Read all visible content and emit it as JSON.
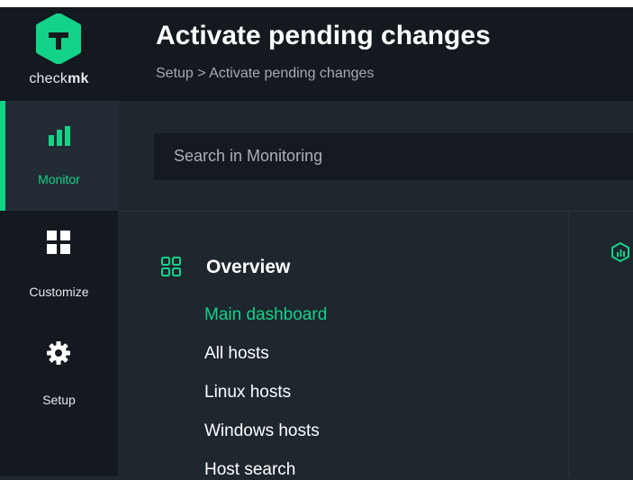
{
  "brand": {
    "logo_text_regular": "check",
    "logo_text_bold": "mk",
    "accent_color": "#13d389"
  },
  "sidebar": {
    "items": [
      {
        "label": "Monitor",
        "icon": "bar-chart-icon",
        "active": true
      },
      {
        "label": "Customize",
        "icon": "grid-icon",
        "active": false
      },
      {
        "label": "Setup",
        "icon": "gear-icon",
        "active": false
      }
    ]
  },
  "header": {
    "title": "Activate pending changes",
    "breadcrumb": "Setup > Activate pending changes"
  },
  "search": {
    "placeholder": "Search in Monitoring"
  },
  "overview": {
    "title": "Overview",
    "icon": "overview-grid-icon",
    "items": [
      {
        "label": "Main dashboard",
        "active": true
      },
      {
        "label": "All hosts",
        "active": false
      },
      {
        "label": "Linux hosts",
        "active": false
      },
      {
        "label": "Windows hosts",
        "active": false
      },
      {
        "label": "Host search",
        "active": false
      }
    ]
  }
}
